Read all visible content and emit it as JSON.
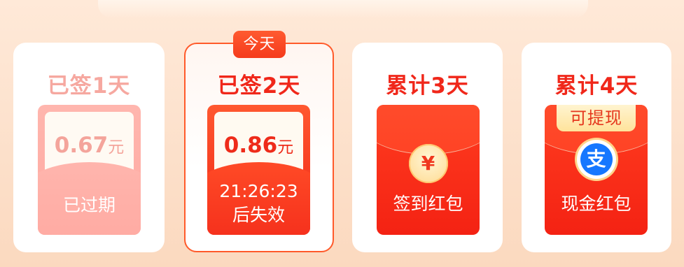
{
  "today_badge": "今天",
  "days": [
    {
      "title": "已签1天",
      "amount": "0.67",
      "unit": "元",
      "status": "已过期"
    },
    {
      "title": "已签2天",
      "amount": "0.86",
      "unit": "元",
      "countdown": "21:26:23",
      "countdown_suffix": "后失效"
    },
    {
      "title": "累计3天",
      "coin_symbol": "¥",
      "label": "签到红包"
    },
    {
      "title": "累计4天",
      "badge": "可提现",
      "alipay_symbol": "支",
      "label": "现金红包"
    }
  ],
  "colors": {
    "accent": "#f0271a",
    "expired": "#f6a8a0",
    "alipay": "#1677ff"
  }
}
